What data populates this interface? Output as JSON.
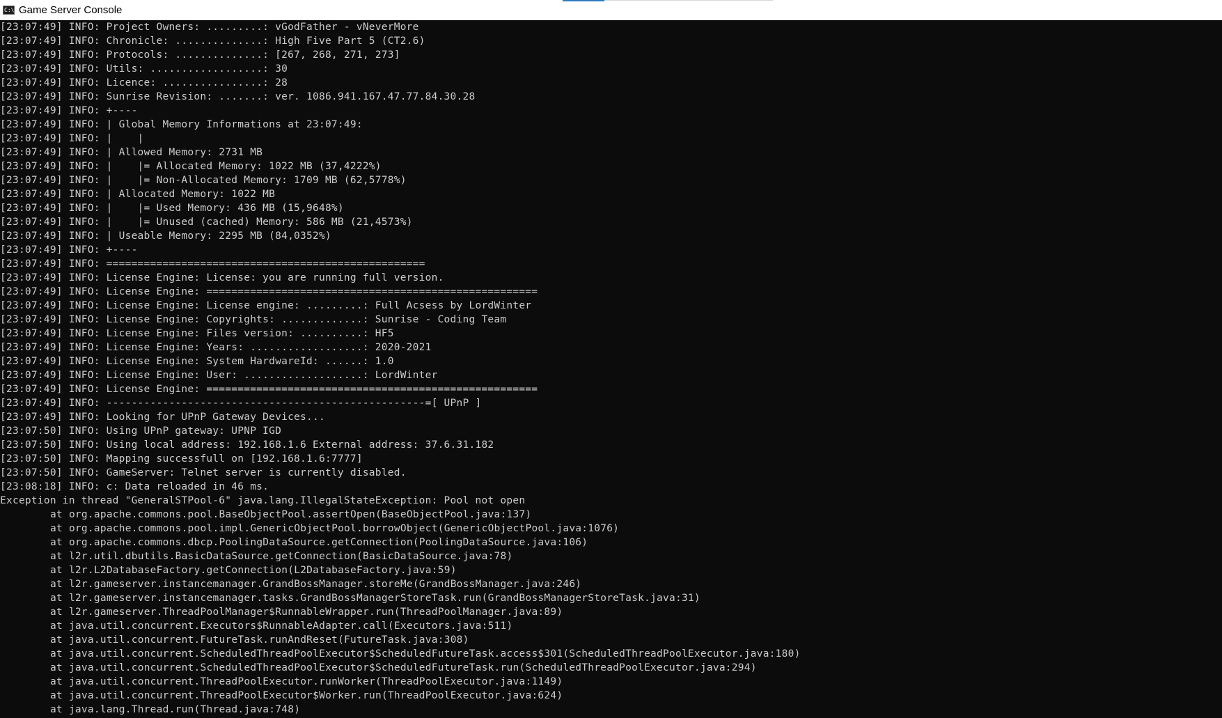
{
  "window": {
    "title": "Game Server Console",
    "icon": "console-app-icon",
    "icon_glyph": "C:\\",
    "colors": {
      "background": "#0c0c0c",
      "text": "#cccccc",
      "titlebar": "#ffffff"
    }
  },
  "console": {
    "lines": [
      "[23:07:49] INFO: Project Owners: .........: vGodFather - vNeverMore",
      "[23:07:49] INFO: Chronicle: ..............: High Five Part 5 (CT2.6)",
      "[23:07:49] INFO: Protocols: ..............: [267, 268, 271, 273]",
      "[23:07:49] INFO: Utils: ..................: 30",
      "[23:07:49] INFO: Licence: ................: 28",
      "[23:07:49] INFO: Sunrise Revision: .......: ver. 1086.941.167.47.77.84.30.28",
      "[23:07:49] INFO: +----",
      "[23:07:49] INFO: | Global Memory Informations at 23:07:49:",
      "[23:07:49] INFO: |    |",
      "[23:07:49] INFO: | Allowed Memory: 2731 MB",
      "[23:07:49] INFO: |    |= Allocated Memory: 1022 MB (37,4222%)",
      "[23:07:49] INFO: |    |= Non-Allocated Memory: 1709 MB (62,5778%)",
      "[23:07:49] INFO: | Allocated Memory: 1022 MB",
      "[23:07:49] INFO: |    |= Used Memory: 436 MB (15,9648%)",
      "[23:07:49] INFO: |    |= Unused (cached) Memory: 586 MB (21,4573%)",
      "[23:07:49] INFO: | Useable Memory: 2295 MB (84,0352%)",
      "[23:07:49] INFO: +----",
      "[23:07:49] INFO: ===================================================",
      "[23:07:49] INFO: License Engine: License: you are running full version.",
      "[23:07:49] INFO: License Engine: =====================================================",
      "[23:07:49] INFO: License Engine: License engine: .........: Full Acsess by LordWinter",
      "[23:07:49] INFO: License Engine: Copyrights: .............: Sunrise - Coding Team",
      "[23:07:49] INFO: License Engine: Files version: ..........: HF5",
      "[23:07:49] INFO: License Engine: Years: ..................: 2020-2021",
      "[23:07:49] INFO: License Engine: System HardwareId: ......: 1.0",
      "[23:07:49] INFO: License Engine: User: ...................: LordWinter",
      "[23:07:49] INFO: License Engine: =====================================================",
      "[23:07:49] INFO: ---------------------------------------------------=[ UPnP ]",
      "[23:07:49] INFO: Looking for UPnP Gateway Devices...",
      "[23:07:50] INFO: Using UPnP gateway: UPNP IGD",
      "[23:07:50] INFO: Using local address: 192.168.1.6 External address: 37.6.31.182",
      "[23:07:50] INFO: Mapping successfull on [192.168.1.6:7777]",
      "[23:07:50] INFO: GameServer: Telnet server is currently disabled.",
      "[23:08:18] INFO: c: Data reloaded in 46 ms.",
      "Exception in thread \"GeneralSTPool-6\" java.lang.IllegalStateException: Pool not open"
    ],
    "stack_trace": [
      "at org.apache.commons.pool.BaseObjectPool.assertOpen(BaseObjectPool.java:137)",
      "at org.apache.commons.pool.impl.GenericObjectPool.borrowObject(GenericObjectPool.java:1076)",
      "at org.apache.commons.dbcp.PoolingDataSource.getConnection(PoolingDataSource.java:106)",
      "at l2r.util.dbutils.BasicDataSource.getConnection(BasicDataSource.java:78)",
      "at l2r.L2DatabaseFactory.getConnection(L2DatabaseFactory.java:59)",
      "at l2r.gameserver.instancemanager.GrandBossManager.storeMe(GrandBossManager.java:246)",
      "at l2r.gameserver.instancemanager.tasks.GrandBossManagerStoreTask.run(GrandBossManagerStoreTask.java:31)",
      "at l2r.gameserver.ThreadPoolManager$RunnableWrapper.run(ThreadPoolManager.java:89)",
      "at java.util.concurrent.Executors$RunnableAdapter.call(Executors.java:511)",
      "at java.util.concurrent.FutureTask.runAndReset(FutureTask.java:308)",
      "at java.util.concurrent.ScheduledThreadPoolExecutor$ScheduledFutureTask.access$301(ScheduledThreadPoolExecutor.java:180)",
      "at java.util.concurrent.ScheduledThreadPoolExecutor$ScheduledFutureTask.run(ScheduledThreadPoolExecutor.java:294)",
      "at java.util.concurrent.ThreadPoolExecutor.runWorker(ThreadPoolExecutor.java:1149)",
      "at java.util.concurrent.ThreadPoolExecutor$Worker.run(ThreadPoolExecutor.java:624)",
      "at java.lang.Thread.run(Thread.java:748)"
    ]
  }
}
